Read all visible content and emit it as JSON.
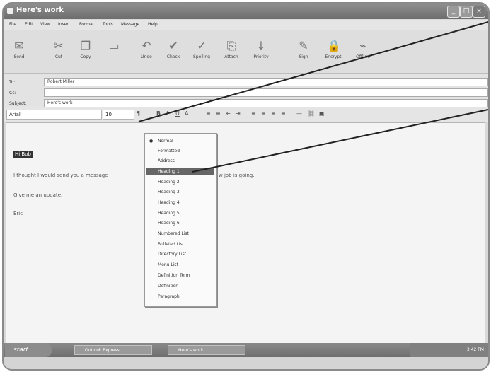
{
  "window": {
    "title": "Here's work",
    "minimize": "_",
    "maximize": "□",
    "close": "×"
  },
  "menu": [
    "File",
    "Edit",
    "View",
    "Insert",
    "Format",
    "Tools",
    "Message",
    "Help"
  ],
  "toolbar": [
    {
      "label": "Send",
      "icon": "send-icon",
      "glyph": "✉"
    },
    {
      "label": "Cut",
      "icon": "cut-icon",
      "glyph": "✂"
    },
    {
      "label": "Copy",
      "icon": "copy-icon",
      "glyph": "❐"
    },
    {
      "label": "",
      "icon": "paste-icon",
      "glyph": "▭"
    },
    {
      "label": "Undo",
      "icon": "undo-icon",
      "glyph": "↶"
    },
    {
      "label": "Check",
      "icon": "check-names-icon",
      "glyph": "✔"
    },
    {
      "label": "Spelling",
      "icon": "spelling-icon",
      "glyph": "✓"
    },
    {
      "label": "Attach",
      "icon": "attach-icon",
      "glyph": "⎘"
    },
    {
      "label": "Priority",
      "icon": "priority-icon",
      "glyph": "↓"
    },
    {
      "label": "Sign",
      "icon": "sign-icon",
      "glyph": "✎"
    },
    {
      "label": "Encrypt",
      "icon": "encrypt-icon",
      "glyph": "🔒"
    },
    {
      "label": "Offline",
      "icon": "offline-icon",
      "glyph": "⌁"
    }
  ],
  "fields": {
    "to_label": "To:",
    "to_value": "Robert Miller",
    "cc_label": "Cc:",
    "cc_value": "",
    "subject_label": "Subject:",
    "subject_value": "Here's work"
  },
  "format": {
    "font": "Arial",
    "size": "10"
  },
  "body": {
    "heading": "Hi Bob",
    "line1": "I thought I would send you a message",
    "line1_tail": "w job is going.",
    "line2": "Give me an update.",
    "line3": "Eric"
  },
  "dropdown": {
    "items": [
      "Normal",
      "Formatted",
      "Address",
      "Heading 1",
      "Heading 2",
      "Heading 3",
      "Heading 4",
      "Heading 5",
      "Heading 6",
      "Numbered List",
      "Bulleted List",
      "Directory List",
      "Menu List",
      "Definition Term",
      "Definition",
      "Paragraph"
    ],
    "checked": "Normal",
    "selected": "Heading 1"
  },
  "taskbar": {
    "start": "start",
    "task1": "Outlook Express",
    "task2": "Here's work",
    "clock": "3:42 PM"
  }
}
